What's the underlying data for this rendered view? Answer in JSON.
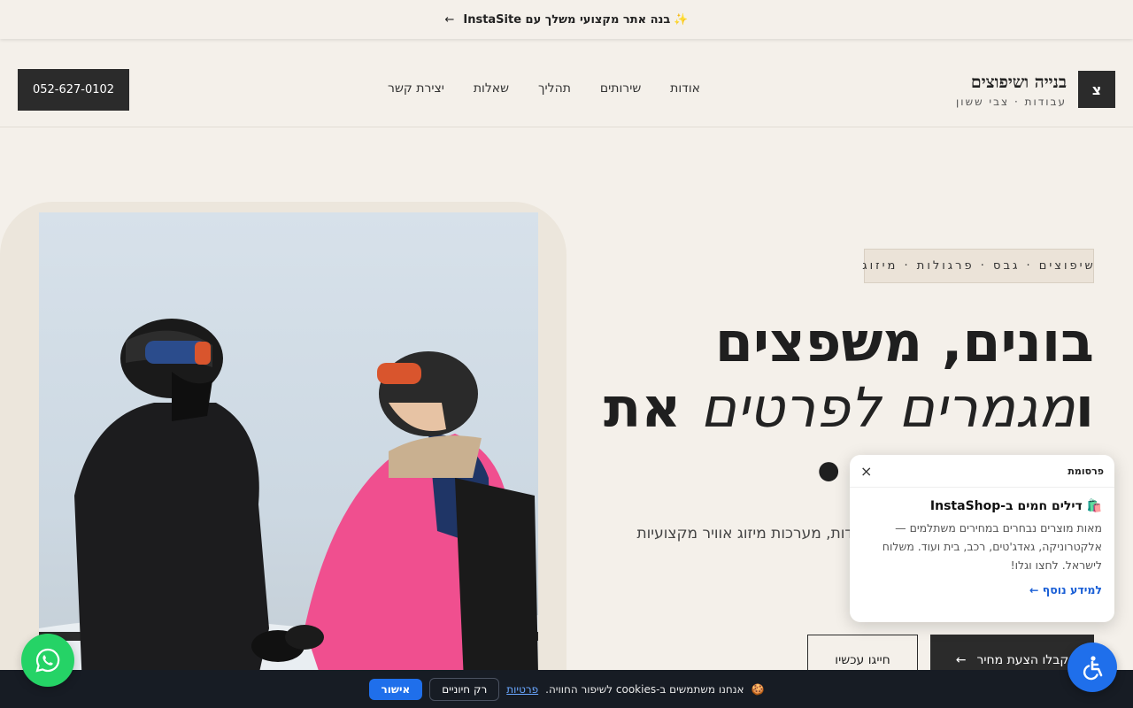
{
  "promo_bar": {
    "sparkle": "✨",
    "text": "בנה אתר מקצועי משלך עם InstaSite",
    "arrow": "←"
  },
  "header": {
    "logo_letter": "צ",
    "brand_name": "בנייה ושיפוצים",
    "brand_tagline": "עבודות · צבי ששון",
    "nav": [
      "אודות",
      "שירותים",
      "תהליך",
      "שאלות",
      "יצירת קשר"
    ],
    "phone": "052-627-0102"
  },
  "hero": {
    "tagline": "שיפוצים · גבס · פרגולות · מיזוג",
    "headline_line1": "בונים, משפצים",
    "headline_line2_a": "ו",
    "headline_line2_accent": "מגמרים לפרטים",
    "headline_line2_b": "את",
    "headline_line3": "•",
    "description": "לווים אתכם מהתכנון ועד המסירה - מידות, מערכות מיזוג אוויר מקצועיות דרך, בזמנים שהובטחו.",
    "cta_primary": "קבלו הצעת מחיר",
    "cta_primary_arrow": "←",
    "cta_secondary": "חייגו עכשיו"
  },
  "ad": {
    "label": "פרסומת",
    "close": "×",
    "emoji": "🛍️",
    "title": "דילים חמים ב-InstaShop",
    "body": "מאות מוצרים נבחרים במחירים משתלמים — אלקטרוניקה, גאדג'טים, רכב, בית ועוד. משלוח לישראל. לחצו וגלו!",
    "link": "למידע נוסף ←"
  },
  "cookie": {
    "emoji": "🍪",
    "text": "אנחנו משתמשים ב-cookies לשיפור החוויה.",
    "privacy_link": "פרטיות",
    "essentials_button": "רק חיוניים",
    "accept_button": "אישור"
  },
  "colors": {
    "background": "#f4f0ea",
    "dark": "#2b2b2b",
    "whatsapp": "#25d366",
    "accessibility": "#1f6feb",
    "cookie_bar": "#171c24",
    "link": "#1a5fd6"
  },
  "icons": {
    "whatsapp": "whatsapp-icon",
    "accessibility": "accessibility-icon",
    "close": "close-icon"
  }
}
